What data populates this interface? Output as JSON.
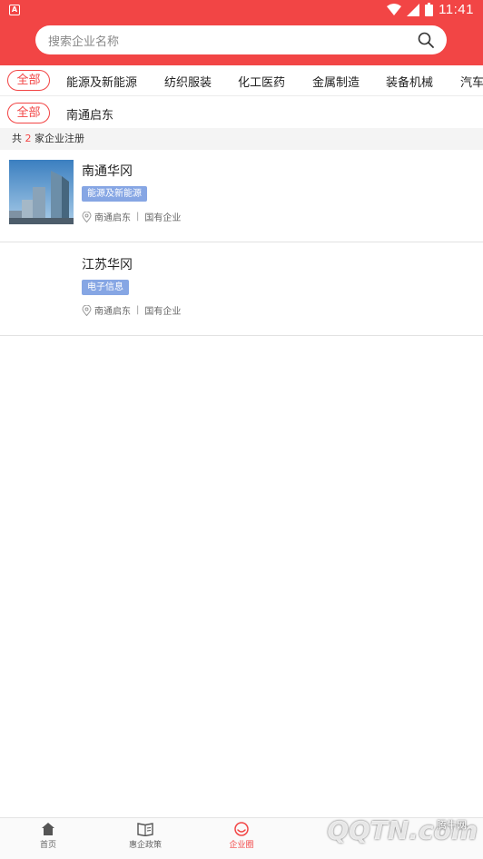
{
  "status": {
    "time": "11:41"
  },
  "search": {
    "placeholder": "搜索企业名称"
  },
  "categories": [
    "全部",
    "能源及新能源",
    "纺织服装",
    "化工医药",
    "金属制造",
    "装备机械",
    "汽车"
  ],
  "regions": {
    "all": "全部",
    "current": "南通启东"
  },
  "count": {
    "prefix": "共",
    "num": "2",
    "suffix": "家企业注册"
  },
  "companies": [
    {
      "name": "南通华冈",
      "tag": "能源及新能源",
      "location": "南通启东",
      "type": "国有企业"
    },
    {
      "name": "江苏华冈",
      "tag": "电子信息",
      "location": "南通启东",
      "type": "国有企业"
    }
  ],
  "tabs": [
    {
      "label": "首页",
      "icon": "home-icon"
    },
    {
      "label": "惠企政策",
      "icon": "policy-icon"
    },
    {
      "label": "企业圈",
      "icon": "enterprise-circle-icon",
      "active": true
    }
  ],
  "watermark": {
    "main": "QQTN.com",
    "small": "腾牛网"
  },
  "colors": {
    "accent": "#f24545",
    "tag": "#86a6e4"
  }
}
